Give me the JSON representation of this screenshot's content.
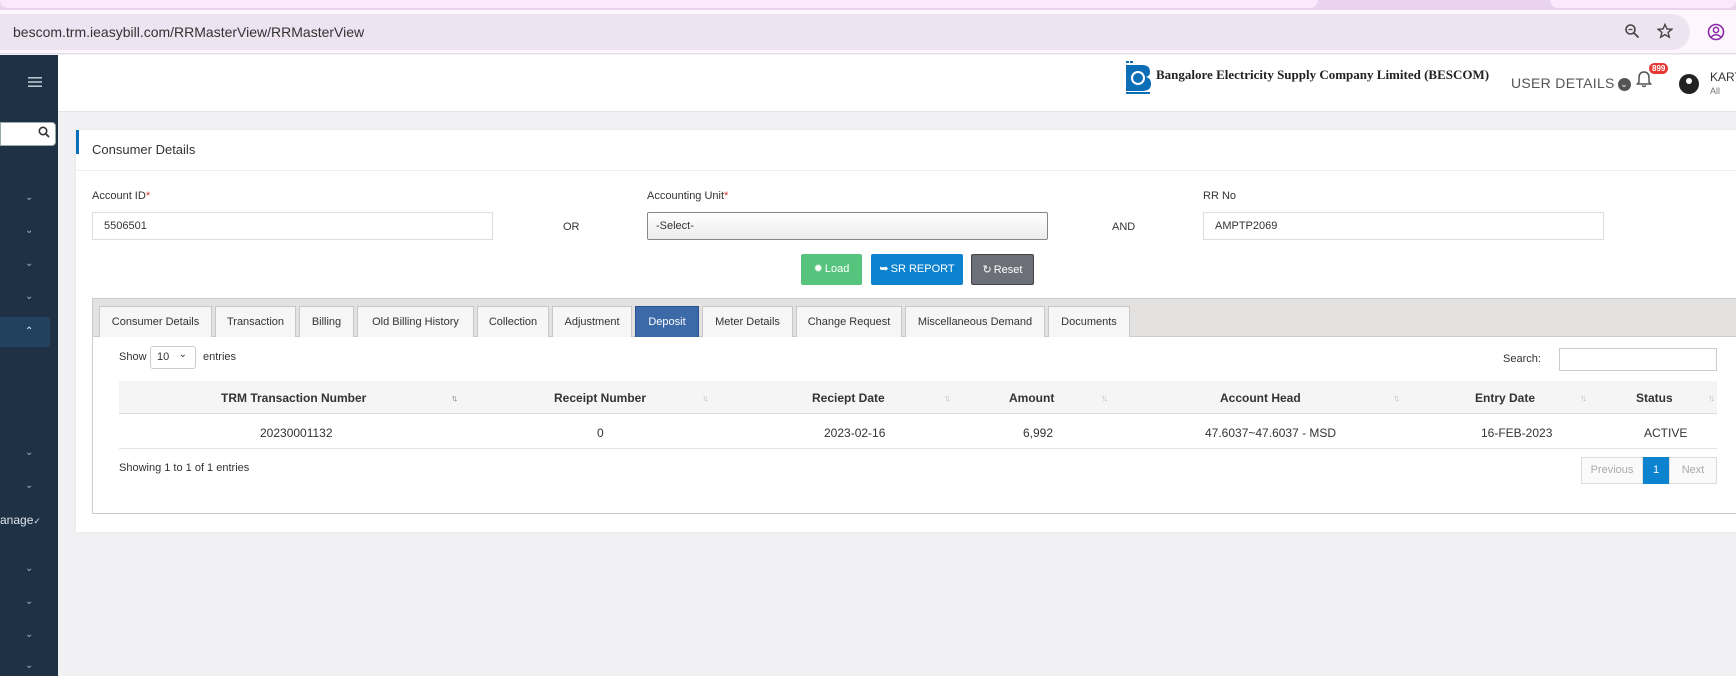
{
  "browser": {
    "url": "bescom.trm.ieasybill.com/RRMasterView/RRMasterView",
    "zoom_icon": "zoom-icon",
    "bookmark_icon": "star-icon",
    "profile_icon": "profile-icon"
  },
  "sidebar": {
    "menu_icon": "hamburger-icon",
    "partial_label": "anage"
  },
  "header": {
    "company": "Bangalore Electricity Supply Company Limited (BESCOM)",
    "user_details": "USER DETAILS",
    "notification_count": "899",
    "user_name": "KART",
    "user_role": "All"
  },
  "consumer": {
    "title": "Consumer Details",
    "account_id_label": "Account ID",
    "account_id_value": "5506501",
    "or_text": "OR",
    "accounting_unit_label": "Accounting Unit",
    "accounting_unit_value": "-Select-",
    "and_text": "AND",
    "rr_no_label": "RR No",
    "rr_no_value": "AMPTP2069",
    "required_mark": "*"
  },
  "buttons": {
    "load": "Load",
    "sr_report": "SR REPORT",
    "reset": "Reset"
  },
  "tabs": [
    {
      "label": "Consumer Details"
    },
    {
      "label": "Transaction"
    },
    {
      "label": "Billing"
    },
    {
      "label": "Old Billing History"
    },
    {
      "label": "Collection"
    },
    {
      "label": "Adjustment"
    },
    {
      "label": "Deposit",
      "active": true
    },
    {
      "label": "Meter Details"
    },
    {
      "label": "Change Request"
    },
    {
      "label": "Miscellaneous Demand"
    },
    {
      "label": "Documents"
    }
  ],
  "table": {
    "show_label": "Show",
    "page_length": "10",
    "entries_label": "entries",
    "search_label": "Search:",
    "columns": [
      "TRM Transaction Number",
      "Receipt Number",
      "Reciept Date",
      "Amount",
      "Account Head",
      "Entry Date",
      "Status"
    ],
    "rows": [
      [
        "20230001132",
        "0",
        "2023-02-16",
        "6,992",
        "47.6037~47.6037 - MSD",
        "16-FEB-2023",
        "ACTIVE"
      ]
    ],
    "info": "Showing 1 to 1 of 1 entries",
    "pagination": {
      "previous": "Previous",
      "current": "1",
      "next": "Next"
    }
  },
  "colors": {
    "sidebar": "#1e3145",
    "accent": "#0d6eb8",
    "active_tab": "#3c6aa8",
    "load_button": "#57c47d",
    "sr_button": "#0d83d0",
    "reset_button": "#6c6f78",
    "badge": "#e53935"
  }
}
